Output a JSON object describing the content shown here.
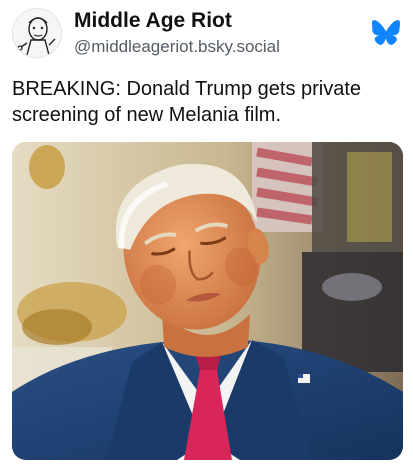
{
  "post": {
    "author": {
      "display_name": "Middle Age Riot",
      "handle": "@middleageriot.bsky.social"
    },
    "text_lines": [
      "BREAKING: Donald Trump gets private",
      "screening of new Melania film."
    ],
    "platform_icon": "butterfly-icon",
    "colors": {
      "accent": "#1185fe",
      "handle": "#555d66",
      "suit": "#1c3f6e",
      "tie": "#d9265a"
    }
  }
}
